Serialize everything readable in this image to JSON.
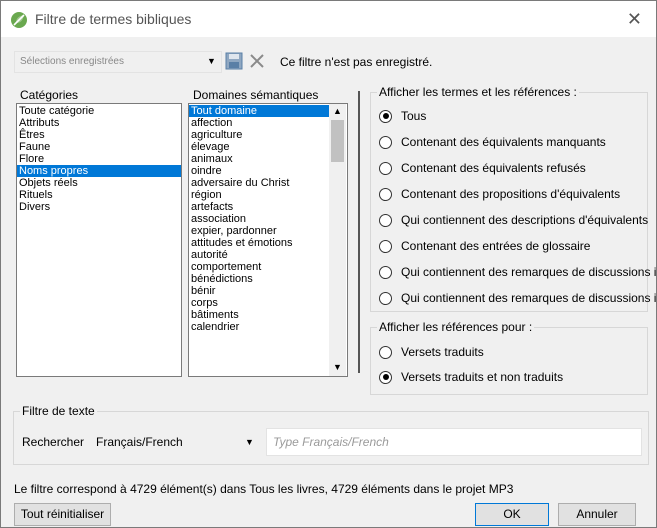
{
  "window": {
    "title": "Filtre de termes bibliques",
    "close_glyph": "✕"
  },
  "toolbar": {
    "saved_selections_placeholder": "Sélections enregistrées",
    "status": "Ce filtre n'est pas enregistré."
  },
  "categories": {
    "label": "Catégories",
    "items": [
      "Toute catégorie",
      "Attributs",
      "Êtres",
      "Faune",
      "Flore",
      "Noms propres",
      "Objets réels",
      "Rituels",
      "Divers"
    ],
    "selected": "Noms propres"
  },
  "domains": {
    "label": "Domaines sémantiques",
    "items": [
      "Tout domaine",
      "affection",
      "agriculture",
      "élevage",
      "animaux",
      "oindre",
      "adversaire du Christ",
      "région",
      "artefacts",
      "association",
      "expier, pardonner",
      "attitudes et émotions",
      "autorité",
      "comportement",
      "bénédictions",
      "bénir",
      "corps",
      "bâtiments",
      "calendrier"
    ],
    "selected": "Tout domaine"
  },
  "show_terms": {
    "label": "Afficher les termes et les références :",
    "options": [
      "Tous",
      "Contenant des équivalents manquants",
      "Contenant des équivalents refusés",
      "Contenant des propositions d'équivalents",
      "Qui contiennent des descriptions d'équivalents",
      "Contenant des entrées de glossaire",
      "Qui contiennent des remarques de discussions i",
      "Qui contiennent des remarques de discussions i"
    ],
    "selected": "Tous"
  },
  "show_refs": {
    "label": "Afficher les références pour :",
    "options": [
      "Versets traduits",
      "Versets traduits et non traduits"
    ],
    "selected": "Versets traduits et non traduits"
  },
  "text_filter": {
    "label": "Filtre de texte",
    "search_label": "Rechercher",
    "language": "Français/French",
    "placeholder": "Type Français/French"
  },
  "footer": {
    "summary": "Le filtre correspond à 4729 élément(s) dans Tous les livres, 4729 éléments dans le projet MP3",
    "reset": "Tout réinitialiser",
    "ok": "OK",
    "cancel": "Annuler"
  },
  "colors": {
    "selection": "#0078d7",
    "accent_green": "#6aa84f",
    "save_icon": "#5a7fa6"
  },
  "icons": {
    "app": "leaf-icon",
    "save": "floppy-disk-icon",
    "delete": "x-icon",
    "dropdown": "triangle-down-icon"
  }
}
